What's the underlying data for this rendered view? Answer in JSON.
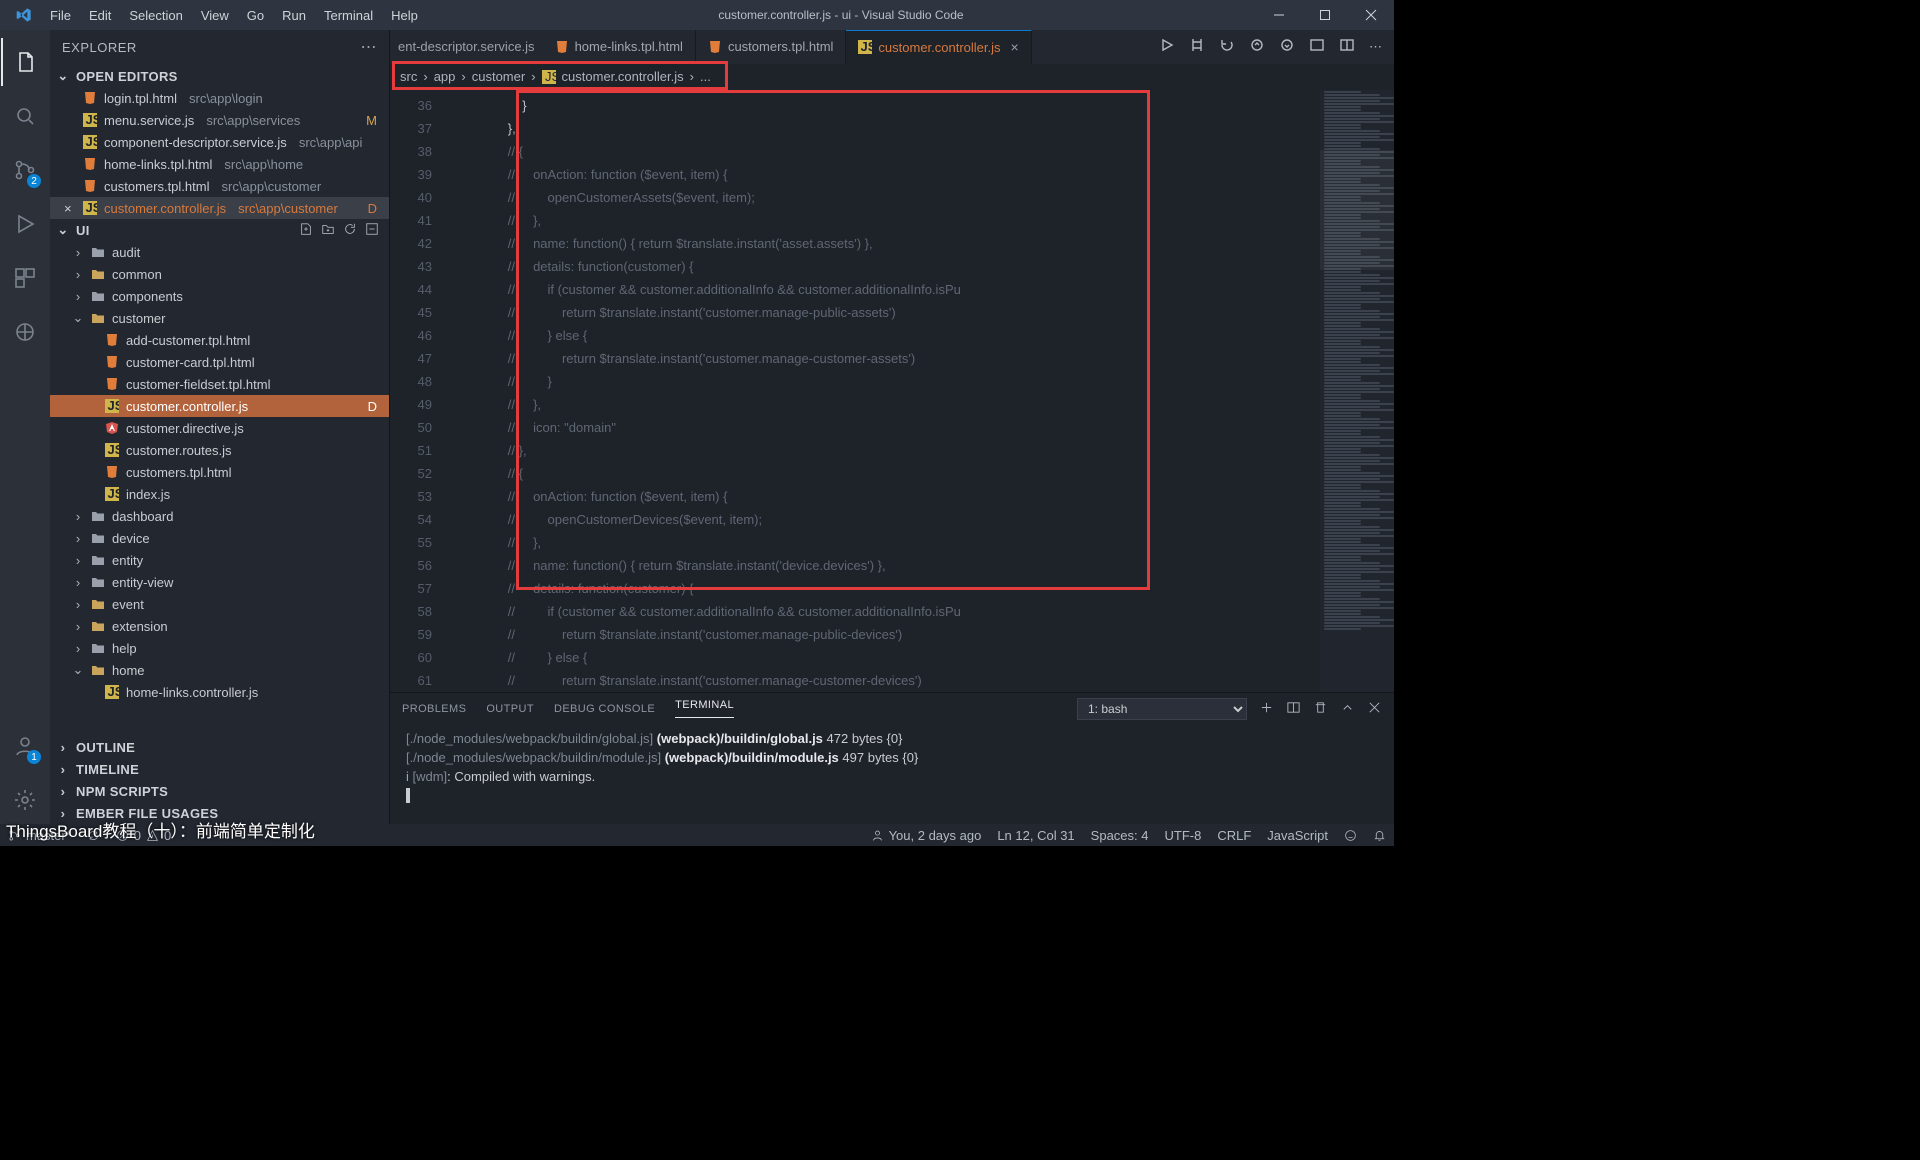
{
  "window_title": "customer.controller.js - ui - Visual Studio Code",
  "menubar": [
    "File",
    "Edit",
    "Selection",
    "View",
    "Go",
    "Run",
    "Terminal",
    "Help"
  ],
  "activity_badges": {
    "scm": "2",
    "account": "1"
  },
  "explorer_title": "EXPLORER",
  "open_editors_label": "OPEN EDITORS",
  "open_editors": [
    {
      "name": "login.tpl.html",
      "path": "src\\app\\login",
      "kind": "html"
    },
    {
      "name": "menu.service.js",
      "path": "src\\app\\services",
      "kind": "js",
      "mod": "M"
    },
    {
      "name": "component-descriptor.service.js",
      "path": "src\\app\\api",
      "kind": "js"
    },
    {
      "name": "home-links.tpl.html",
      "path": "src\\app\\home",
      "kind": "html"
    },
    {
      "name": "customers.tpl.html",
      "path": "src\\app\\customer",
      "kind": "html"
    },
    {
      "name": "customer.controller.js",
      "path": "src\\app\\customer",
      "kind": "js",
      "mod": "D",
      "dirty": true,
      "active": true,
      "prefix": "×"
    }
  ],
  "project_name": "UI",
  "tree": [
    {
      "indent": 1,
      "kind": "folder",
      "open": false,
      "name": "audit"
    },
    {
      "indent": 1,
      "kind": "folder-open",
      "open": false,
      "name": "common"
    },
    {
      "indent": 1,
      "kind": "folder",
      "open": false,
      "name": "components"
    },
    {
      "indent": 1,
      "kind": "folder-open",
      "open": true,
      "name": "customer"
    },
    {
      "indent": 2,
      "kind": "html",
      "name": "add-customer.tpl.html"
    },
    {
      "indent": 2,
      "kind": "html",
      "name": "customer-card.tpl.html"
    },
    {
      "indent": 2,
      "kind": "html",
      "name": "customer-fieldset.tpl.html"
    },
    {
      "indent": 2,
      "kind": "js",
      "name": "customer.controller.js",
      "mod": "D",
      "active": true
    },
    {
      "indent": 2,
      "kind": "ang",
      "name": "customer.directive.js"
    },
    {
      "indent": 2,
      "kind": "js",
      "name": "customer.routes.js"
    },
    {
      "indent": 2,
      "kind": "html",
      "name": "customers.tpl.html"
    },
    {
      "indent": 2,
      "kind": "js",
      "name": "index.js"
    },
    {
      "indent": 1,
      "kind": "folder",
      "open": false,
      "name": "dashboard"
    },
    {
      "indent": 1,
      "kind": "folder",
      "open": false,
      "name": "device"
    },
    {
      "indent": 1,
      "kind": "folder",
      "open": false,
      "name": "entity"
    },
    {
      "indent": 1,
      "kind": "folder",
      "open": false,
      "name": "entity-view"
    },
    {
      "indent": 1,
      "kind": "folder-open",
      "open": false,
      "name": "event"
    },
    {
      "indent": 1,
      "kind": "folder-open",
      "open": false,
      "name": "extension"
    },
    {
      "indent": 1,
      "kind": "folder",
      "open": false,
      "name": "help"
    },
    {
      "indent": 1,
      "kind": "folder-open",
      "open": true,
      "name": "home"
    },
    {
      "indent": 2,
      "kind": "js",
      "name": "home-links.controller.js"
    }
  ],
  "explorer_collapsed": [
    "OUTLINE",
    "TIMELINE",
    "NPM SCRIPTS",
    "EMBER FILE USAGES"
  ],
  "tabs_trunc": "ent-descriptor.service.js",
  "tabs": [
    {
      "name": "home-links.tpl.html",
      "kind": "html"
    },
    {
      "name": "customers.tpl.html",
      "kind": "html"
    },
    {
      "name": "customer.controller.js",
      "kind": "js",
      "active": true,
      "dirty": true,
      "close": "×"
    }
  ],
  "breadcrumb": [
    "src",
    "app",
    "customer",
    "customer.controller.js",
    "..."
  ],
  "line_start": 37,
  "code_preline_num": "36",
  "code_preline": "                    }",
  "code": [
    "                },",
    "                // {",
    "                //     onAction: function ($event, item) {",
    "                //         openCustomerAssets($event, item);",
    "                //     },",
    "                //     name: function() { return $translate.instant('asset.assets') },",
    "                //     details: function(customer) {",
    "                //         if (customer && customer.additionalInfo && customer.additionalInfo.isPu",
    "                //             return $translate.instant('customer.manage-public-assets')",
    "                //         } else {",
    "                //             return $translate.instant('customer.manage-customer-assets')",
    "                //         }",
    "                //     },",
    "                //     icon: \"domain\"",
    "                // },",
    "                // {",
    "                //     onAction: function ($event, item) {",
    "                //         openCustomerDevices($event, item);",
    "                //     },",
    "                //     name: function() { return $translate.instant('device.devices') },",
    "                //     details: function(customer) {",
    "                //         if (customer && customer.additionalInfo && customer.additionalInfo.isPu",
    "                //             return $translate.instant('customer.manage-public-devices')",
    "                //         } else {",
    "                //             return $translate.instant('customer.manage-customer-devices')"
  ],
  "panel_tabs": [
    "PROBLEMS",
    "OUTPUT",
    "DEBUG CONSOLE",
    "TERMINAL"
  ],
  "panel_active": "TERMINAL",
  "terminal_select": "1: bash",
  "terminal_lines": [
    {
      "d": "   ",
      "p": "[./node_modules/webpack/buildin/global.js] ",
      "b": "(webpack)/buildin/global.js",
      "r": " 472 bytes ",
      "br": "{0}"
    },
    {
      "d": "   ",
      "p": "[./node_modules/webpack/buildin/module.js] ",
      "b": "(webpack)/buildin/module.js",
      "r": " 497 bytes ",
      "br": "{0}"
    }
  ],
  "terminal_final": {
    "pre": "i ",
    "tag": "[wdm]",
    "rest": ": Compiled with warnings."
  },
  "status": {
    "branch": "master*",
    "sync": "",
    "errors": "0",
    "warnings": "0",
    "blame": "You, 2 days ago",
    "pos": "Ln 12, Col 31",
    "spaces": "Spaces: 4",
    "enc": "UTF-8",
    "eol": "CRLF",
    "lang": "JavaScript"
  },
  "caption": "ThingsBoard教程（十）：前端简单定制化"
}
